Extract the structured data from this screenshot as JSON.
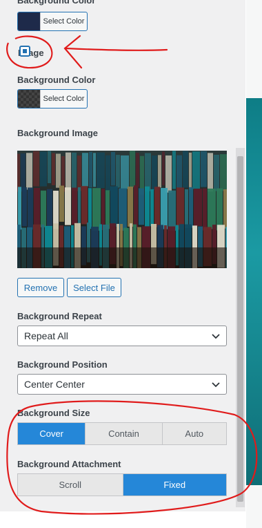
{
  "section_top": {
    "label": "Background Color",
    "button": "Select Color",
    "swatch_color": "#1e2a4a"
  },
  "image_toggle": {
    "label": "Image",
    "checked": true
  },
  "background_color": {
    "label": "Background Color",
    "button": "Select Color"
  },
  "background_image": {
    "label": "Background Image",
    "image_desc": "books-photo",
    "remove_label": "Remove",
    "select_label": "Select File"
  },
  "background_repeat": {
    "label": "Background Repeat",
    "value": "Repeat All"
  },
  "background_position": {
    "label": "Background Position",
    "value": "Center Center"
  },
  "background_size": {
    "label": "Background Size",
    "options": [
      "Cover",
      "Contain",
      "Auto"
    ],
    "selected": "Cover"
  },
  "background_attachment": {
    "label": "Background Attachment",
    "options": [
      "Scroll",
      "Fixed"
    ],
    "selected": "Fixed"
  },
  "colors": {
    "accent": "#2271b1",
    "active_segment": "#2587d8",
    "annotation_red": "#e01b1b"
  }
}
